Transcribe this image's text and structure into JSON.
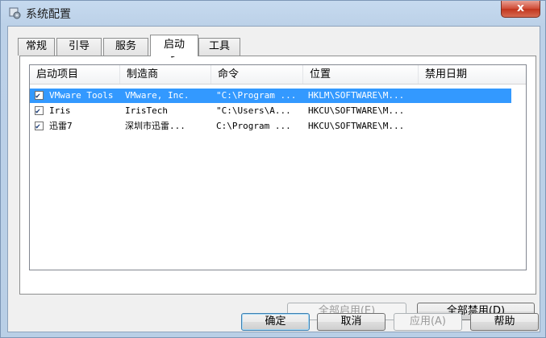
{
  "window": {
    "title": "系统配置"
  },
  "tabs": [
    "常规",
    "引导",
    "服务",
    "启动",
    "工具"
  ],
  "active_tab": "启动",
  "columns": [
    "启动项目",
    "制造商",
    "命令",
    "位置",
    "禁用日期"
  ],
  "rows": [
    {
      "checked": true,
      "item": "VMware Tools",
      "maker": "VMware, Inc.",
      "command": "\"C:\\Program ...",
      "location": "HKLM\\SOFTWARE\\M...",
      "date": ""
    },
    {
      "checked": true,
      "item": "Iris",
      "maker": "IrisTech",
      "command": "\"C:\\Users\\A...",
      "location": "HKCU\\SOFTWARE\\M...",
      "date": ""
    },
    {
      "checked": true,
      "item": "迅雷7",
      "maker": "深圳市迅雷...",
      "command": "C:\\Program ...",
      "location": "HKCU\\SOFTWARE\\M...",
      "date": ""
    }
  ],
  "buttons": {
    "enable_all": "全部启用(E)",
    "disable_all": "全部禁用(D)",
    "ok": "确定",
    "cancel": "取消",
    "apply": "应用(A)",
    "help": "帮助"
  },
  "close_glyph": "x"
}
